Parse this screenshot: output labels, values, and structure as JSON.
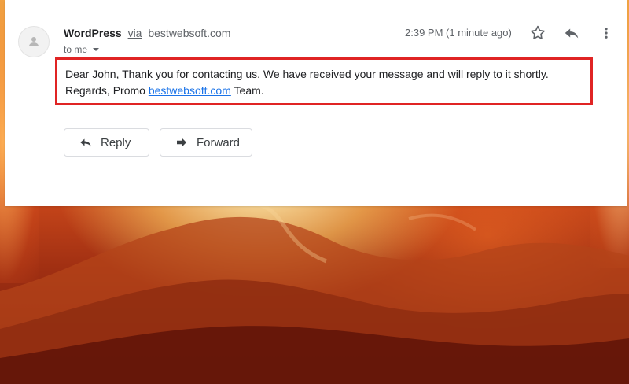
{
  "email": {
    "sender": {
      "name": "WordPress",
      "via_label": "via",
      "domain": "bestwebsoft.com"
    },
    "recipient_label": "to me",
    "time": "2:39 PM (1 minute ago)",
    "body": {
      "text_before_link": "Dear John, Thank you for contacting us. We have received your message and will reply to it shortly. Regards, Promo ",
      "link_text": "bestwebsoft.com",
      "text_after_link": " Team."
    },
    "actions": {
      "reply_label": "Reply",
      "forward_label": "Forward"
    }
  },
  "colors": {
    "highlight": "#e02424",
    "link": "#1a73e8",
    "card": "#ffffff"
  },
  "icons": {
    "avatar": "person-icon",
    "star": "star-icon",
    "reply": "reply-icon",
    "more": "more-vert-icon",
    "chevron": "chevron-down-icon",
    "forward": "forward-icon"
  }
}
